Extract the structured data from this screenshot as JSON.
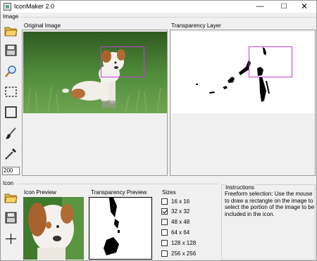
{
  "window": {
    "title": "IconMaker 2.0",
    "controls": {
      "minimize": "—",
      "maximize": "☐",
      "close": "✕"
    }
  },
  "image_section": {
    "label": "Image",
    "tools": [
      {
        "name": "open",
        "icon": "folder-open-icon"
      },
      {
        "name": "save",
        "icon": "floppy-disk-icon"
      },
      {
        "name": "zoom",
        "icon": "magnifier-icon"
      },
      {
        "name": "freeform-select",
        "icon": "dashed-rectangle-icon"
      },
      {
        "name": "rectangle",
        "icon": "rectangle-icon"
      },
      {
        "name": "brush",
        "icon": "brush-icon"
      },
      {
        "name": "eyedropper",
        "icon": "eyedropper-icon"
      }
    ],
    "brush_size_value": "200",
    "original_label": "Original Image",
    "transparency_label": "Transparency Layer"
  },
  "icon_section": {
    "label": "Icon",
    "tools": [
      {
        "name": "open",
        "icon": "folder-open-icon"
      },
      {
        "name": "save",
        "icon": "floppy-disk-icon"
      },
      {
        "name": "add",
        "icon": "plus-icon"
      }
    ],
    "preview_label": "Icon Preview",
    "transparency_preview_label": "Transparency Preview",
    "sizes_label": "Sizes",
    "sizes": [
      {
        "label": "16 x 16",
        "checked": false
      },
      {
        "label": "32 x 32",
        "checked": true
      },
      {
        "label": "48 x 48",
        "checked": false
      },
      {
        "label": "64 x 64",
        "checked": false
      },
      {
        "label": "128 x 128",
        "checked": false
      },
      {
        "label": "256 x 256",
        "checked": false
      }
    ]
  },
  "instructions": {
    "title": "Instructions",
    "text": "Freeform selection: Use the mouse to draw a rectangle on the image to select the portion of the image to be included in the icon."
  },
  "colors": {
    "selection": "#c33fd1",
    "grass": "#4f8a3a",
    "window_bg": "#f0f0f0"
  }
}
